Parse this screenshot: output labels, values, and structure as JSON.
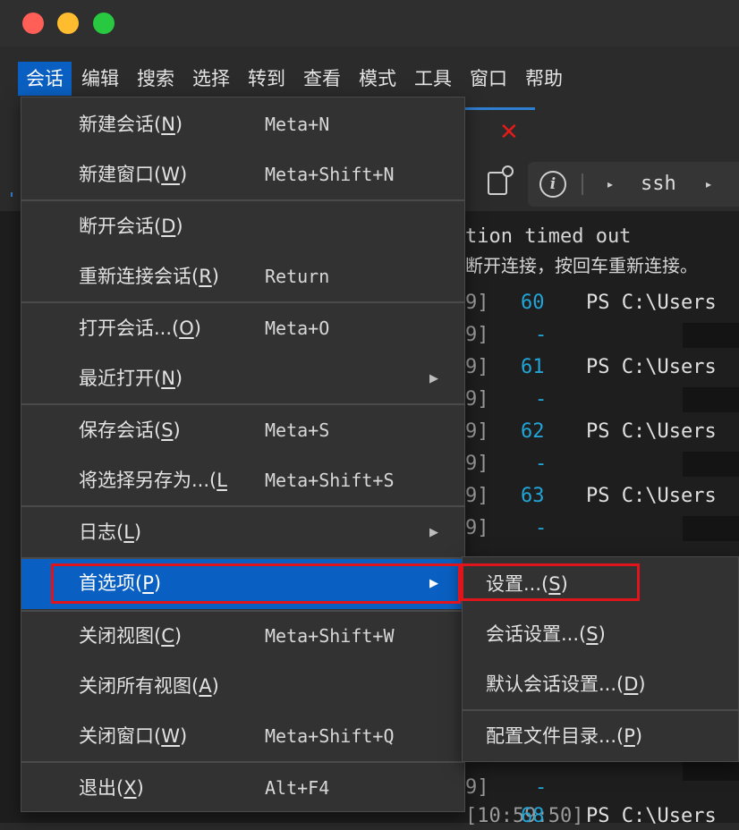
{
  "window": {
    "traffic_lights": [
      "#ff5f57",
      "#febc2e",
      "#28c840"
    ]
  },
  "menubar": {
    "items": [
      "会话",
      "编辑",
      "搜索",
      "选择",
      "转到",
      "查看",
      "模式",
      "工具",
      "窗口",
      "帮助"
    ],
    "active_index": 0
  },
  "tab": {
    "close_symbol": "✕"
  },
  "toolbar": {
    "info_symbol": "i",
    "caret_symbol": "▸",
    "session_label": "ssh"
  },
  "terminal": {
    "message_line1": "tion timed out",
    "message_line2": "断开连接，按回车重新连接。",
    "bracket_frag": "9]",
    "rows": [
      {
        "num": "60",
        "ps": "PS C:\\Users"
      },
      {
        "num": "61",
        "ps": "PS C:\\Users"
      },
      {
        "num": "62",
        "ps": "PS C:\\Users"
      },
      {
        "num": "63",
        "ps": "PS C:\\Users"
      }
    ],
    "dash": "-",
    "bottom_left": "[10:59:50]",
    "bottom_num": "68",
    "bottom_ps": "PS C:\\Users"
  },
  "menu": {
    "items": [
      {
        "pre": "新建会话(",
        "key": "N",
        "post": ")",
        "shortcut": "Meta+N"
      },
      {
        "pre": "新建窗口(",
        "key": "W",
        "post": ")",
        "shortcut": "Meta+Shift+N"
      },
      {
        "pre": "断开会话(",
        "key": "D",
        "post": ")",
        "shortcut": ""
      },
      {
        "pre": "重新连接会话(",
        "key": "R",
        "post": ")",
        "shortcut": "Return"
      },
      {
        "pre": "打开会话...(",
        "key": "O",
        "post": ")",
        "shortcut": "Meta+O"
      },
      {
        "pre": "最近打开(",
        "key": "N",
        "post": ")",
        "shortcut": "",
        "submenu": true
      },
      {
        "pre": "保存会话(",
        "key": "S",
        "post": ")",
        "shortcut": "Meta+S"
      },
      {
        "pre": "将选择另存为...(",
        "key": "L",
        "post": "",
        "shortcut": "Meta+Shift+S"
      },
      {
        "pre": "日志(",
        "key": "L",
        "post": ")",
        "shortcut": "",
        "submenu": true
      },
      {
        "pre": "首选项(",
        "key": "P",
        "post": ")",
        "shortcut": "",
        "submenu": true,
        "selected": true
      },
      {
        "pre": "关闭视图(",
        "key": "C",
        "post": ")",
        "shortcut": "Meta+Shift+W"
      },
      {
        "pre": "关闭所有视图(",
        "key": "A",
        "post": ")",
        "shortcut": ""
      },
      {
        "pre": "关闭窗口(",
        "key": "W",
        "post": ")",
        "shortcut": "Meta+Shift+Q"
      },
      {
        "pre": "退出(",
        "key": "X",
        "post": ")",
        "shortcut": "Alt+F4"
      }
    ],
    "arrow_symbol": "▶"
  },
  "submenu": {
    "items": [
      {
        "pre": "设置...(",
        "key": "S",
        "post": ")"
      },
      {
        "pre": "会话设置...(",
        "key": "S",
        "post": ")"
      },
      {
        "pre": "默认会话设置...(",
        "key": "D",
        "post": ")"
      },
      {
        "pre": "配置文件目录...(",
        "key": "P",
        "post": ")"
      }
    ]
  },
  "highlight_color": "#e0141b",
  "accent_color": "#0a60c2"
}
